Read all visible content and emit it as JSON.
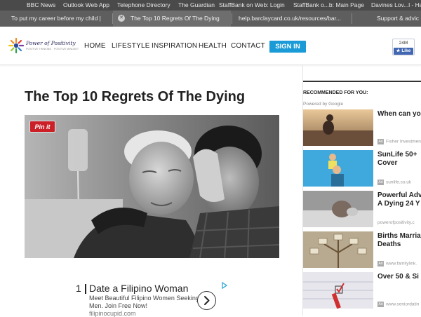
{
  "bookmarks": [
    "BBC News",
    "Outlook Web App",
    "Telephone Directory",
    "The Guardian",
    "StaffBank on Web: Login",
    "StaffBank o...b: Main Page",
    "Davines Lov...l - Hai"
  ],
  "tabs": [
    {
      "label": "To put my career before my child |"
    },
    {
      "label": "The Top 10 Regrets Of The Dying"
    },
    {
      "label": "help.barclaycard.co.uk/resources/bar..."
    },
    {
      "label": "Support & advic"
    }
  ],
  "site": {
    "logo_name": "Power of Positivity",
    "logo_tagline": "POSITIVE THINKING · POSITIVE MINDSET",
    "nav": [
      "HOME",
      "LIFESTYLE",
      "INSPIRATION",
      "HEALTH",
      "CONTACT"
    ],
    "signin_label": "SIGN IN",
    "fb_count": "24M",
    "fb_like": "Like"
  },
  "article": {
    "title": "The Top 10 Regrets Of The Dying",
    "pin_label": "Pin it"
  },
  "ad": {
    "rank": "1",
    "title": "Date a Filipino Woman",
    "body": "Meet Beautiful Filipino Women Seeking UK Men. Join Free Now!",
    "url": "filipinocupid.com"
  },
  "sidebar": {
    "heading": "RECOMMENDED FOR YOU:",
    "powered_by": "Powered by Google",
    "items": [
      {
        "title": "When can yo",
        "source": "Fisher Investmen"
      },
      {
        "title": "SunLife 50+ Cover",
        "source": "sunlife.co.uk"
      },
      {
        "title": "Powerful Adv A Dying 24 Y",
        "source": "powerofpositivity.c"
      },
      {
        "title": "Births Marria Deaths",
        "source": "www.familylink."
      },
      {
        "title": "Over 50 & Si",
        "source": "www.seniordatin"
      }
    ]
  },
  "colors": {
    "accent": "#1a9bd7",
    "pinterest": "#cb2027",
    "facebook": "#4267b2",
    "bookmarks_bg": "#4a4a4a",
    "tabbar_bg": "#5e5e5e"
  }
}
